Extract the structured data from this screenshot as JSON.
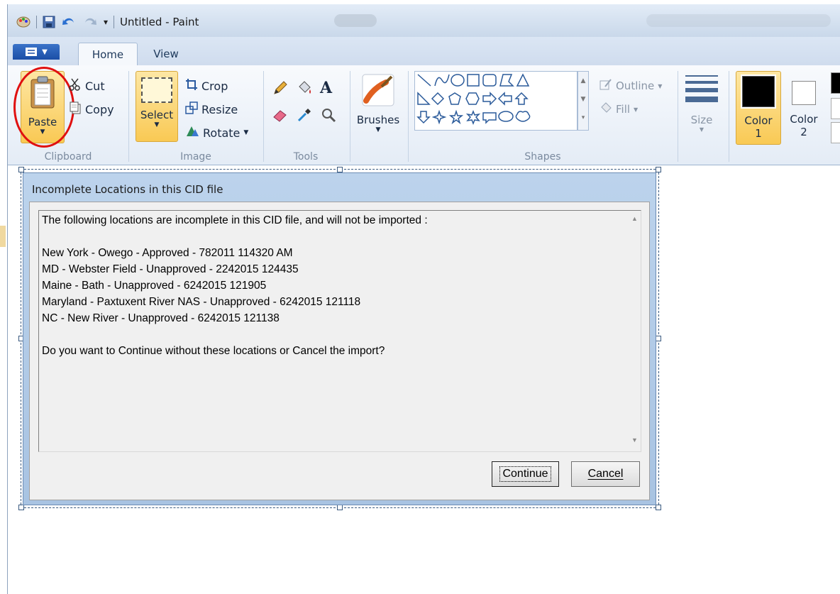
{
  "window": {
    "title": "Untitled - Paint"
  },
  "tabs": {
    "home": "Home",
    "view": "View"
  },
  "clipboard": {
    "paste": "Paste",
    "cut": "Cut",
    "copy": "Copy",
    "group": "Clipboard"
  },
  "image": {
    "select": "Select",
    "crop": "Crop",
    "resize": "Resize",
    "rotate": "Rotate",
    "group": "Image"
  },
  "tools": {
    "group": "Tools"
  },
  "brushes": {
    "label": "Brushes"
  },
  "shapes": {
    "outline": "Outline",
    "fill": "Fill",
    "group": "Shapes"
  },
  "size": {
    "label": "Size"
  },
  "colors": {
    "color1_label": "Color",
    "color1_num": "1",
    "color2_label": "Color",
    "color2_num": "2",
    "color1_value": "#000000",
    "color2_value": "#ffffff"
  },
  "dialog": {
    "title": "Incomplete Locations in this CID file",
    "lines": [
      "The following locations are incomplete in this CID file, and will not be imported :",
      "New York - Owego - Approved - 782011 114320 AM",
      "MD - Webster Field  - Unapproved - 2242015 124435",
      "Maine - Bath - Unapproved - 6242015 121905",
      "Maryland - Paxtuxent River NAS - Unapproved - 6242015 121118",
      "NC - New River - Unapproved - 6242015 121138",
      "Do you want to Continue without these locations or Cancel the import?"
    ],
    "continue_btn": "Continue",
    "cancel_btn": "Cancel"
  }
}
